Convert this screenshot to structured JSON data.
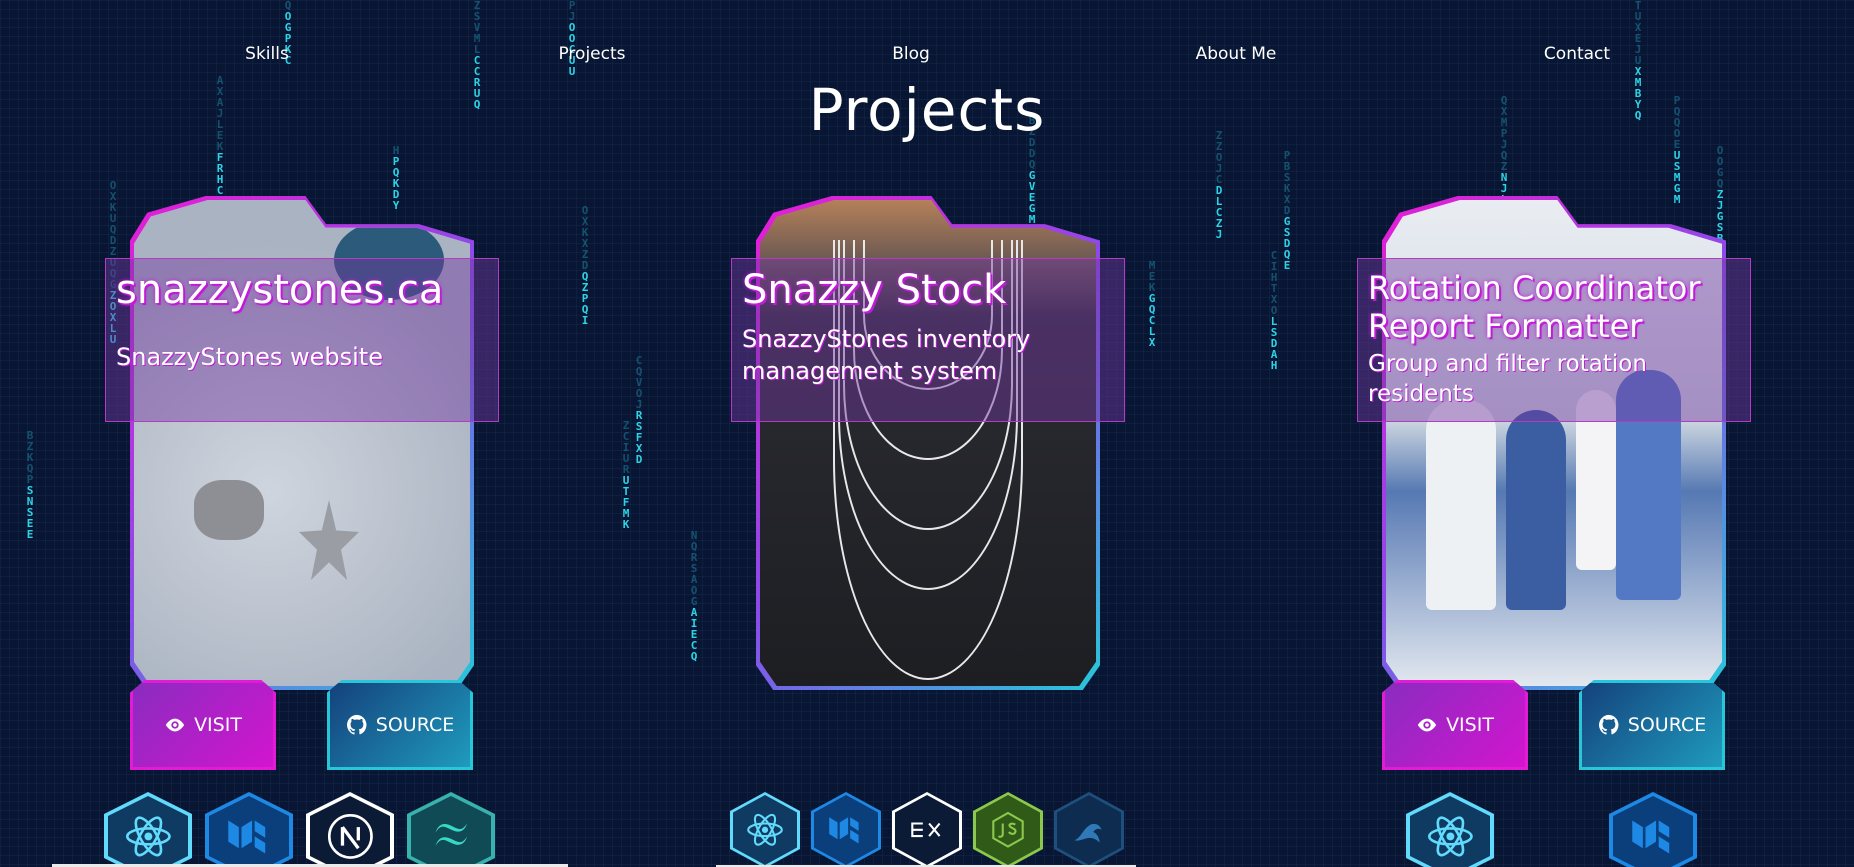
{
  "nav": {
    "items": [
      "Skills",
      "Projects",
      "Blog",
      "About Me",
      "Contact"
    ]
  },
  "page": {
    "title": "Projects"
  },
  "projects": [
    {
      "title": "snazzystones.ca",
      "description": "SnazzyStones website",
      "visit_label": "VISIT",
      "source_label": "SOURCE",
      "tech_icons": [
        "react-icon",
        "material-ui-icon",
        "nextjs-icon",
        "tailwind-icon"
      ]
    },
    {
      "title": "Snazzy Stock",
      "description": "SnazzyStones inventory management system",
      "tech_icons": [
        "react-icon",
        "material-ui-icon",
        "express-icon",
        "nodejs-icon",
        "mysql-icon"
      ]
    },
    {
      "title": "Rotation Coordinator Report Formatter",
      "description": "Group and filter rotation residents",
      "visit_label": "VISIT",
      "source_label": "SOURCE",
      "tech_icons": [
        "react-icon",
        "material-ui-icon"
      ]
    }
  ],
  "background_rain": [
    "QOGPKC",
    "ZSVMLCCRUQ",
    "PJOOCUU",
    "TUXEJUXMBYQ",
    "AXAJLEKFRHCP",
    "OXKUQDZUQGZOXLU",
    "OXKXZDQZPQI",
    "HPQKDY",
    "QXMPJQZNJLNB",
    "BZDDQGVEGM",
    "ZZOJCDLCZJ",
    "PBSKXDGSDQE",
    "PQQOEUSMGM",
    "OOGQZJGSB",
    "MEKGQCLX",
    "CIHTXOLSDAH",
    "CQVOJRSFXD",
    "ZCIURUTFMK",
    "NQRSAOGAIECQ",
    "BZKQPSNSEE"
  ],
  "colors": {
    "background": "#081633",
    "accent_magenta": "#e31ad6",
    "accent_cyan": "#27c7d9"
  }
}
